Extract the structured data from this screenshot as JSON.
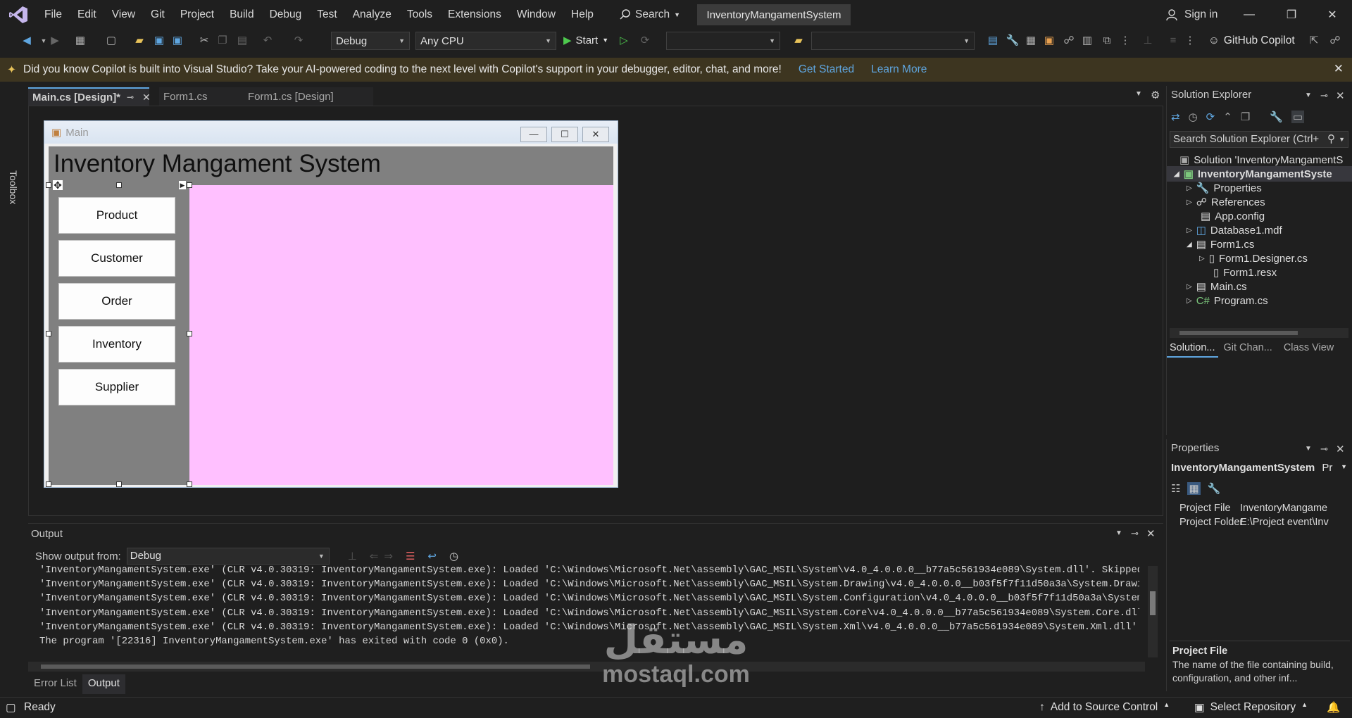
{
  "titlebar": {
    "menu": [
      "File",
      "Edit",
      "View",
      "Git",
      "Project",
      "Build",
      "Debug",
      "Test",
      "Analyze",
      "Tools",
      "Extensions",
      "Window",
      "Help"
    ],
    "search_label": "Search",
    "solution_name": "InventoryMangamentSystem",
    "sign_in": "Sign in"
  },
  "toolbar": {
    "config": "Debug",
    "platform": "Any CPU",
    "start_label": "Start",
    "copilot_label": "GitHub Copilot"
  },
  "infobar": {
    "message": "Did you know Copilot is built into Visual Studio? Take your AI-powered coding to the next level with Copilot's support in your debugger, editor, chat, and more!",
    "get_started": "Get Started",
    "learn_more": "Learn More"
  },
  "toolbox_label": "Toolbox",
  "doc_tabs": [
    {
      "label": "Main.cs [Design]*"
    },
    {
      "label": "Form1.cs"
    },
    {
      "label": "Form1.cs [Design]"
    }
  ],
  "form": {
    "window_title": "Main",
    "header_text": "Inventory Mangament System",
    "buttons": [
      "Product",
      "Customer",
      "Order",
      "Inventory",
      "Supplier"
    ],
    "colors": {
      "header_panel": "#808080",
      "side_panel": "#808080",
      "content_panel": "#ffc0ff"
    }
  },
  "output": {
    "title": "Output",
    "show_from_label": "Show output from:",
    "show_from_value": "Debug",
    "lines": [
      "'InventoryMangamentSystem.exe' (CLR v4.0.30319: InventoryMangamentSystem.exe): Loaded 'C:\\Windows\\Microsoft.Net\\assembly\\GAC_MSIL\\System\\v4.0_4.0.0.0__b77a5c561934e089\\System.dll'. Skipped loading",
      "'InventoryMangamentSystem.exe' (CLR v4.0.30319: InventoryMangamentSystem.exe): Loaded 'C:\\Windows\\Microsoft.Net\\assembly\\GAC_MSIL\\System.Drawing\\v4.0_4.0.0.0__b03f5f7f11d50a3a\\System.Drawing.dll'.",
      "'InventoryMangamentSystem.exe' (CLR v4.0.30319: InventoryMangamentSystem.exe): Loaded 'C:\\Windows\\Microsoft.Net\\assembly\\GAC_MSIL\\System.Configuration\\v4.0_4.0.0.0__b03f5f7f11d50a3a\\System.Configu",
      "'InventoryMangamentSystem.exe' (CLR v4.0.30319: InventoryMangamentSystem.exe): Loaded 'C:\\Windows\\Microsoft.Net\\assembly\\GAC_MSIL\\System.Core\\v4.0_4.0.0.0__b77a5c561934e089\\System.Core.dll'. Skipp",
      "'InventoryMangamentSystem.exe' (CLR v4.0.30319: InventoryMangamentSystem.exe): Loaded 'C:\\Windows\\Microsoft.Net\\assembly\\GAC_MSIL\\System.Xml\\v4.0_4.0.0.0__b77a5c561934e089\\System.Xml.dll'. Skipped",
      "The program '[22316] InventoryMangamentSystem.exe' has exited with code 0 (0x0)."
    ]
  },
  "bottom_tabs": [
    "Error List",
    "Output"
  ],
  "solution_explorer": {
    "title": "Solution Explorer",
    "search_placeholder": "Search Solution Explorer (Ctrl+",
    "items": [
      {
        "label": "Solution 'InventoryMangamentS"
      },
      {
        "label": "InventoryMangamentSyste"
      },
      {
        "label": "Properties"
      },
      {
        "label": "References"
      },
      {
        "label": "App.config"
      },
      {
        "label": "Database1.mdf"
      },
      {
        "label": "Form1.cs"
      },
      {
        "label": "Form1.Designer.cs"
      },
      {
        "label": "Form1.resx"
      },
      {
        "label": "Main.cs"
      },
      {
        "label": "Program.cs"
      }
    ],
    "tabs": [
      "Solution...",
      "Git Chan...",
      "Class View"
    ]
  },
  "properties": {
    "title": "Properties",
    "object": "InventoryMangamentSystem",
    "object_suffix": "Pr",
    "rows": [
      {
        "name": "Project File",
        "value": "InventoryMangame"
      },
      {
        "name": "Project Folder",
        "value": "E:\\Project event\\Inv"
      }
    ],
    "desc_title": "Project File",
    "desc_text": "The name of the file containing build, configuration, and other inf..."
  },
  "status": {
    "ready": "Ready",
    "add_source": "Add to Source Control",
    "select_repo": "Select Repository"
  },
  "watermark": {
    "arabic": "مستقل",
    "latin": "mostaql.com"
  }
}
